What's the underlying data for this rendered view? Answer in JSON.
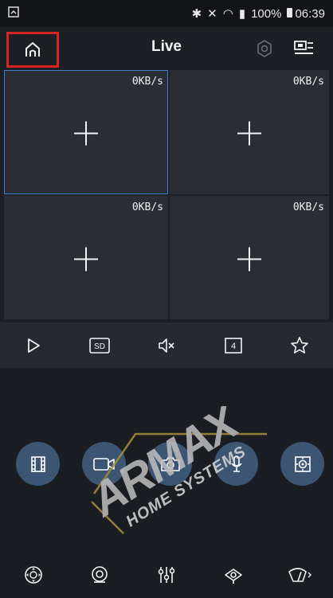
{
  "status_bar": {
    "battery": "100%",
    "time": "06:39"
  },
  "header": {
    "title": "Live"
  },
  "grid": {
    "cells": [
      {
        "rate": "0KB/s",
        "selected": true
      },
      {
        "rate": "0KB/s",
        "selected": false
      },
      {
        "rate": "0KB/s",
        "selected": false
      },
      {
        "rate": "0KB/s",
        "selected": false
      }
    ]
  },
  "controls": {
    "sd_label": "SD",
    "split_count": "4"
  },
  "watermark": {
    "line1": "ARMAX",
    "line2": "HOME SYSTEMS"
  },
  "colors": {
    "highlight": "#d82323",
    "selected_border": "#3f7fd0",
    "circle_fill": "#3c5573"
  }
}
